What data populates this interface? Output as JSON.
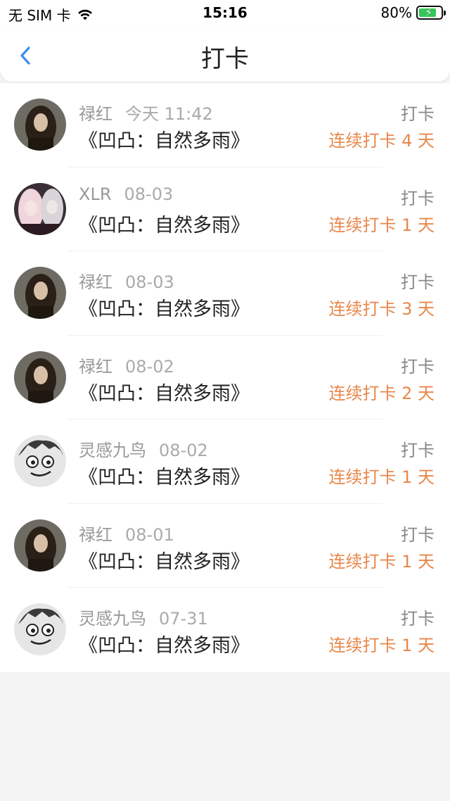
{
  "status_bar": {
    "carrier": "无 SIM 卡",
    "time": "15:16",
    "battery": "80%",
    "battery_level": 0.8,
    "wifi_icon": "wifi-icon",
    "battery_icon": "battery-charging-icon"
  },
  "nav": {
    "title": "打卡",
    "back_icon": "chevron-left-icon"
  },
  "colors": {
    "accent": "#e8874b",
    "back": "#3b8ef0",
    "name": "#999999",
    "title": "#222222"
  },
  "checkins": [
    {
      "name": "禄红",
      "date": "今天 11:42",
      "book": "《凹凸：自然多雨》",
      "label": "打卡",
      "streak": "连续打卡 4 天",
      "avatar": "portrait-woman"
    },
    {
      "name": "XLR",
      "date": "08-03",
      "book": "《凹凸：自然多雨》",
      "label": "打卡",
      "streak": "连续打卡 1 天",
      "avatar": "anime-girls"
    },
    {
      "name": "禄红",
      "date": "08-03",
      "book": "《凹凸：自然多雨》",
      "label": "打卡",
      "streak": "连续打卡 3 天",
      "avatar": "portrait-woman"
    },
    {
      "name": "禄红",
      "date": "08-02",
      "book": "《凹凸：自然多雨》",
      "label": "打卡",
      "streak": "连续打卡 2 天",
      "avatar": "portrait-woman"
    },
    {
      "name": "灵感九鸟",
      "date": "08-02",
      "book": "《凹凸：自然多雨》",
      "label": "打卡",
      "streak": "连续打卡 1 天",
      "avatar": "cartoon-face"
    },
    {
      "name": "禄红",
      "date": "08-01",
      "book": "《凹凸：自然多雨》",
      "label": "打卡",
      "streak": "连续打卡 1 天",
      "avatar": "portrait-woman"
    },
    {
      "name": "灵感九鸟",
      "date": "07-31",
      "book": "《凹凸：自然多雨》",
      "label": "打卡",
      "streak": "连续打卡 1 天",
      "avatar": "cartoon-face"
    }
  ]
}
